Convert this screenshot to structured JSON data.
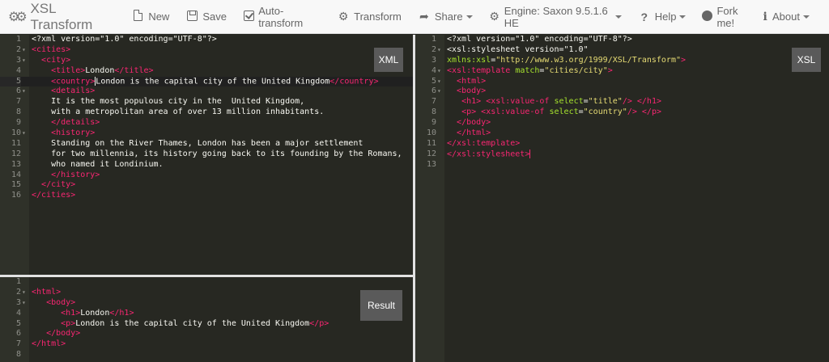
{
  "navbar": {
    "title": "XSL Transform",
    "items": [
      {
        "label": "New",
        "icon": "file-icon"
      },
      {
        "label": "Save",
        "icon": "save-icon"
      },
      {
        "label": "Auto-transform",
        "icon": "checkbox-icon"
      },
      {
        "label": "Transform",
        "icon": "gear-icon"
      },
      {
        "label": "Share",
        "icon": "share-icon"
      },
      {
        "label": "Engine: Saxon 9.5.1.6 HE",
        "icon": "gears-icon"
      },
      {
        "label": "Help",
        "icon": "question-icon"
      }
    ],
    "right_items": [
      {
        "label": "Fork me!",
        "icon": "github-icon"
      },
      {
        "label": "About",
        "icon": "info-icon"
      }
    ]
  },
  "buttons": {
    "xml": "XML",
    "xsl": "XSL",
    "result": "Result"
  },
  "xml_editor": {
    "lines": [
      "<?xml version=\"1.0\" encoding=\"UTF-8\"?>",
      "<cities>",
      "  <city>",
      "    <title>London</title>",
      "    <country>London is the capital city of the United Kingdom</country>",
      "    <details>",
      "    It is the most populous city in the  United Kingdom,",
      "    with a metropolitan area of over 13 million inhabitants.",
      "    </details>",
      "    <history>",
      "    Standing on the River Thames, London has been a major settlement",
      "    for two millennia, its history going back to its founding by the Romans,",
      "    who named it Londinium.",
      "    </history>",
      "  </city>",
      "</cities>"
    ]
  },
  "xsl_editor": {
    "lines": [
      "<?xml version=\"1.0\" encoding=\"UTF-8\"?>",
      "<xsl:stylesheet version=\"1.0\"",
      "xmlns:xsl=\"http://www.w3.org/1999/XSL/Transform\">",
      "<xsl:template match=\"cities/city\">",
      "  <html>",
      "  <body>",
      "   <h1> <xsl:value-of select=\"title\"/> </h1>",
      "   <p> <xsl:value-of select=\"country\"/> </p>",
      "  </body>",
      "  </html>",
      "</xsl:template>",
      "</xsl:stylesheet>",
      ""
    ]
  },
  "result_editor": {
    "lines": [
      "",
      "<html>",
      "   <body>",
      "      <h1>London</h1>",
      "      <p>London is the capital city of the United Kingdom</p>",
      "   </body>",
      "</html>",
      ""
    ]
  },
  "colors": {
    "tag": "#f92672",
    "attribute": "#a6e22e",
    "string": "#e6db74",
    "text": "#f8f8f2",
    "background": "#272822"
  }
}
